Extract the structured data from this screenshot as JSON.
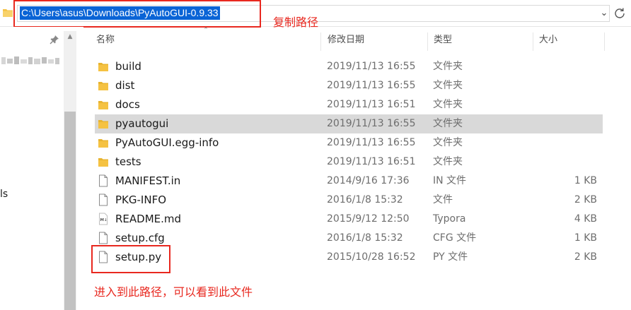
{
  "address_bar": {
    "path": "C:\\Users\\asus\\Downloads\\PyAutoGUI-0.9.33",
    "dropdown_icon": "chevron-down-icon",
    "refresh_icon": "refresh-icon"
  },
  "annotations": {
    "copy_path": "复制路径",
    "enter_path": "进入到此路径，可以看到此文件"
  },
  "nav_pane": {
    "pin_icon": "pin-icon",
    "truncated_label": "ls"
  },
  "columns": {
    "name": "名称",
    "date": "修改日期",
    "type": "类型",
    "size": "大小"
  },
  "files": [
    {
      "name": "build",
      "date": "2019/11/13 16:55",
      "type": "文件夹",
      "size": "",
      "icon": "folder-icon"
    },
    {
      "name": "dist",
      "date": "2019/11/13 16:55",
      "type": "文件夹",
      "size": "",
      "icon": "folder-icon"
    },
    {
      "name": "docs",
      "date": "2019/11/13 16:51",
      "type": "文件夹",
      "size": "",
      "icon": "folder-icon"
    },
    {
      "name": "pyautogui",
      "date": "2019/11/13 16:55",
      "type": "文件夹",
      "size": "",
      "icon": "folder-icon",
      "selected": true
    },
    {
      "name": "PyAutoGUI.egg-info",
      "date": "2019/11/13 16:55",
      "type": "文件夹",
      "size": "",
      "icon": "folder-icon"
    },
    {
      "name": "tests",
      "date": "2019/11/13 16:51",
      "type": "文件夹",
      "size": "",
      "icon": "folder-icon"
    },
    {
      "name": "MANIFEST.in",
      "date": "2014/9/16 17:36",
      "type": "IN 文件",
      "size": "1 KB",
      "icon": "file-icon"
    },
    {
      "name": "PKG-INFO",
      "date": "2016/1/8 15:32",
      "type": "文件",
      "size": "2 KB",
      "icon": "file-icon"
    },
    {
      "name": "README.md",
      "date": "2015/9/12 12:50",
      "type": "Typora",
      "size": "4 KB",
      "icon": "markdown-file-icon"
    },
    {
      "name": "setup.cfg",
      "date": "2016/1/8 15:32",
      "type": "CFG 文件",
      "size": "1 KB",
      "icon": "file-icon"
    },
    {
      "name": "setup.py",
      "date": "2015/10/28 16:52",
      "type": "PY 文件",
      "size": "2 KB",
      "icon": "file-icon"
    }
  ],
  "colors": {
    "accent_selection": "#0a64d6",
    "annotation_red": "#e8281f",
    "folder_yellow": "#f5c242",
    "row_selected": "#d9d9d9"
  }
}
